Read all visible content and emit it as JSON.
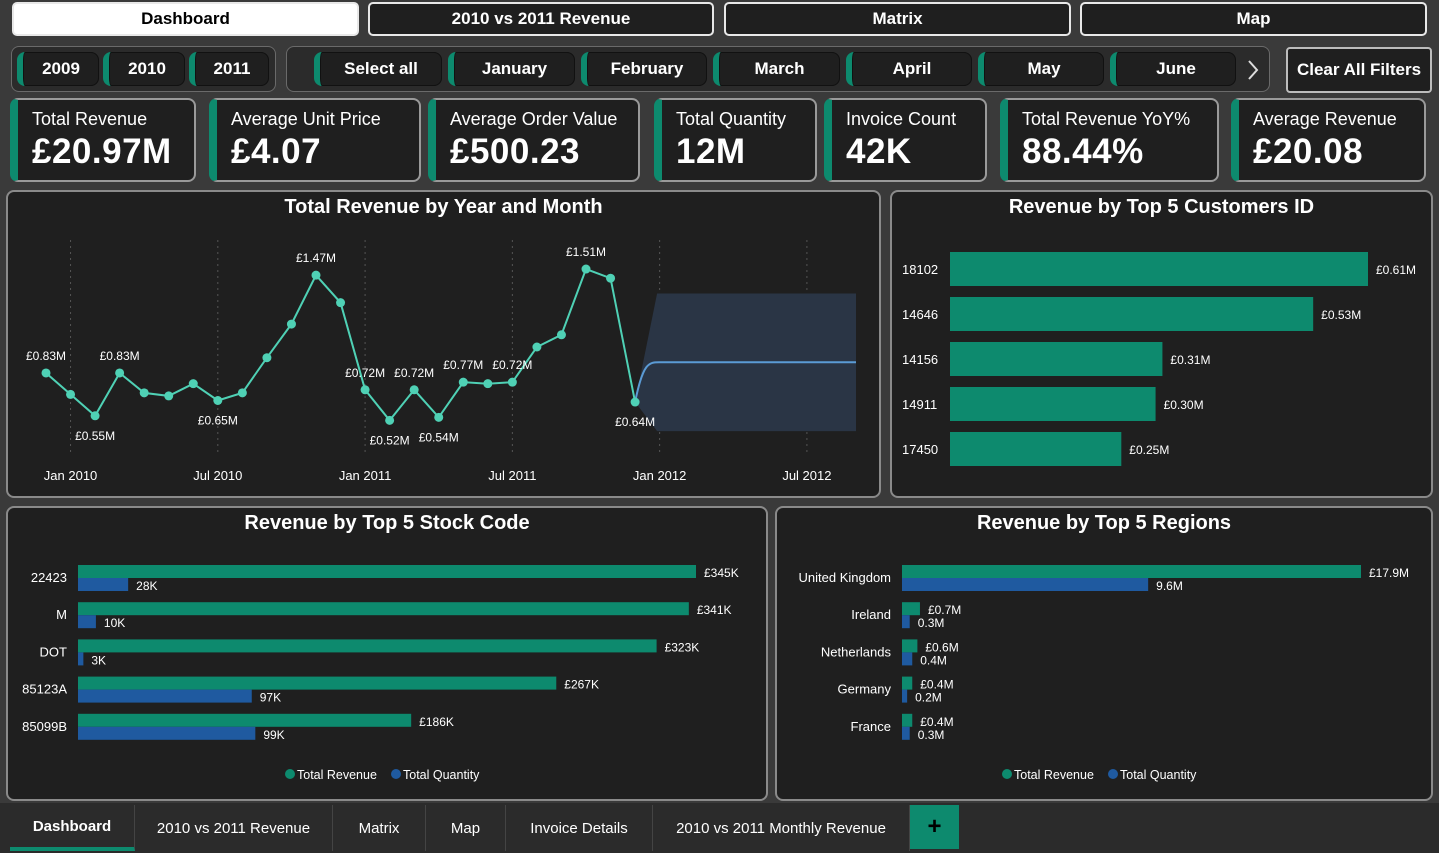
{
  "nav": {
    "buttons": [
      "Dashboard",
      "2010 vs 2011 Revenue",
      "Matrix",
      "Map"
    ],
    "active": "Dashboard"
  },
  "year_slicer": [
    "2009",
    "2010",
    "2011"
  ],
  "month_slicer": [
    "Select all",
    "January",
    "February",
    "March",
    "April",
    "May",
    "June"
  ],
  "clear_filters_label": "Clear All Filters",
  "kpis": [
    {
      "title": "Total Revenue",
      "value": "£20.97M"
    },
    {
      "title": "Average Unit Price",
      "value": "£4.07"
    },
    {
      "title": "Average Order Value",
      "value": "£500.23"
    },
    {
      "title": "Total Quantity",
      "value": "12M"
    },
    {
      "title": "Invoice Count",
      "value": "42K"
    },
    {
      "title": "Total Revenue YoY%",
      "value": "88.44%"
    },
    {
      "title": "Average Revenue",
      "value": "£20.08"
    }
  ],
  "colors": {
    "accent": "#0d8a6e",
    "quantity": "#1f5aa0",
    "line": "#4fd1b5",
    "forecast": "#5b9bd5",
    "forecast_band": "#2a3545",
    "panel": "#1f1f1f"
  },
  "chart_data": [
    {
      "type": "line",
      "title": "Total Revenue by Year and Month",
      "x_tick_labels": [
        "Jan 2010",
        "Jul 2010",
        "Jan 2011",
        "Jul 2011",
        "Jan 2012",
        "Jul 2012"
      ],
      "x": [
        "2009-12",
        "2010-01",
        "2010-02",
        "2010-03",
        "2010-04",
        "2010-05",
        "2010-06",
        "2010-07",
        "2010-08",
        "2010-09",
        "2010-10",
        "2010-11",
        "2010-12",
        "2011-01",
        "2011-02",
        "2011-03",
        "2011-04",
        "2011-05",
        "2011-06",
        "2011-07",
        "2011-08",
        "2011-09",
        "2011-10",
        "2011-11",
        "2011-12"
      ],
      "values": [
        0.83,
        0.69,
        0.55,
        0.83,
        0.7,
        0.68,
        0.76,
        0.65,
        0.7,
        0.93,
        1.15,
        1.47,
        1.29,
        0.72,
        0.52,
        0.72,
        0.54,
        0.77,
        0.76,
        0.77,
        1.0,
        1.08,
        1.51,
        1.45,
        0.64
      ],
      "point_labels": [
        {
          "x": "2009-12",
          "text": "£0.83M"
        },
        {
          "x": "2010-02",
          "text": "£0.55M"
        },
        {
          "x": "2010-03",
          "text": "£0.83M"
        },
        {
          "x": "2010-07",
          "text": "£0.65M"
        },
        {
          "x": "2010-11",
          "text": "£1.47M"
        },
        {
          "x": "2011-01",
          "text": "£0.72M"
        },
        {
          "x": "2011-02",
          "text": "£0.52M"
        },
        {
          "x": "2011-03",
          "text": "£0.72M"
        },
        {
          "x": "2011-04",
          "text": "£0.54M"
        },
        {
          "x": "2011-05",
          "text": "£0.77M"
        },
        {
          "x": "2011-07",
          "text": "£0.72M"
        },
        {
          "x": "2011-10",
          "text": "£1.51M"
        },
        {
          "x": "2011-12",
          "text": "£0.64M"
        }
      ],
      "forecast": {
        "start": "2011-12",
        "end": "2012-09",
        "value": 0.9,
        "band": [
          0.45,
          1.35
        ]
      },
      "ylim": [
        0.3,
        1.7
      ]
    },
    {
      "type": "bar",
      "title": "Revenue by Top 5 Customers ID",
      "categories": [
        "18102",
        "14646",
        "14156",
        "14911",
        "17450"
      ],
      "values": [
        0.61,
        0.53,
        0.31,
        0.3,
        0.25
      ],
      "data_labels": [
        "£0.61M",
        "£0.53M",
        "£0.31M",
        "£0.30M",
        "£0.25M"
      ],
      "xlim": [
        0,
        0.61
      ]
    },
    {
      "type": "bar",
      "title": "Revenue by Top 5 Stock Code",
      "categories": [
        "22423",
        "M",
        "DOT",
        "85123A",
        "85099B"
      ],
      "series": [
        {
          "name": "Total Revenue",
          "values": [
            345,
            341,
            323,
            267,
            186
          ],
          "labels": [
            "£345K",
            "£341K",
            "£323K",
            "£267K",
            "£186K"
          ]
        },
        {
          "name": "Total Quantity",
          "values": [
            28,
            10,
            3,
            97,
            99
          ],
          "labels": [
            "28K",
            "10K",
            "3K",
            "97K",
            "99K"
          ]
        }
      ],
      "xlim": [
        0,
        345
      ]
    },
    {
      "type": "bar",
      "title": "Revenue by Top 5 Regions",
      "categories": [
        "United Kingdom",
        "Ireland",
        "Netherlands",
        "Germany",
        "France"
      ],
      "series": [
        {
          "name": "Total Revenue",
          "values": [
            17.9,
            0.7,
            0.6,
            0.4,
            0.4
          ],
          "labels": [
            "£17.9M",
            "£0.7M",
            "£0.6M",
            "£0.4M",
            "£0.4M"
          ]
        },
        {
          "name": "Total Quantity",
          "values": [
            9.6,
            0.3,
            0.4,
            0.2,
            0.3
          ],
          "labels": [
            "9.6M",
            "0.3M",
            "0.4M",
            "0.2M",
            "0.3M"
          ]
        }
      ],
      "xlim": [
        0,
        17.9
      ]
    }
  ],
  "tabs": [
    "Dashboard",
    "2010 vs 2011 Revenue",
    "Matrix",
    "Map",
    "Invoice Details",
    "2010 vs 2011 Monthly Revenue"
  ],
  "tab_add_icon": "+"
}
